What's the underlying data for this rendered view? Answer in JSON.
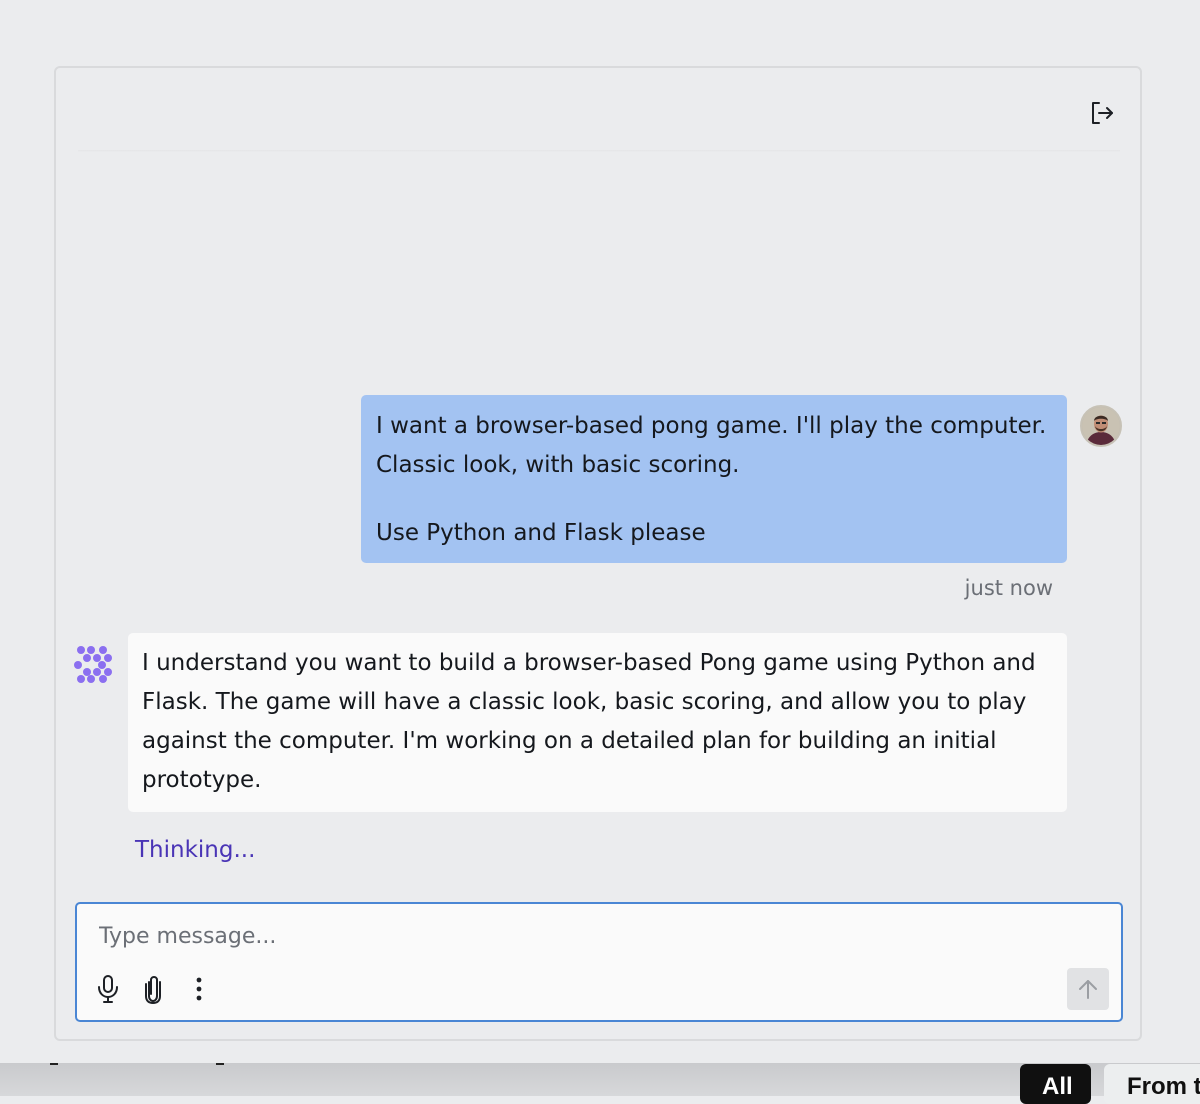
{
  "chat": {
    "messages": [
      {
        "role": "user",
        "lines": [
          "I want a browser-based pong game. I'll play the computer.",
          "Classic look, with basic scoring.",
          "Use Python and Flask please"
        ],
        "timestamp": "just now"
      },
      {
        "role": "assistant",
        "text": "I understand you want to build a browser-based Pong game using Python and Flask. The game will have a classic look, basic scoring, and allow you to play against the computer. I'm working on a detailed plan for building an initial prototype."
      }
    ],
    "status": "Thinking..."
  },
  "composer": {
    "placeholder": "Type message..."
  },
  "icons": {
    "exit": "logout-icon",
    "mic": "microphone-icon",
    "attach": "paperclip-icon",
    "more": "more-vertical-icon",
    "send": "arrow-up-icon",
    "bot": "assistant-logo-icon"
  },
  "filters": {
    "all": "All",
    "from": "From t"
  },
  "colors": {
    "user_bubble": "#a3c3f2",
    "assistant_bubble": "#fafafa",
    "accent": "#4a35b6",
    "logo": "#8b6ff0",
    "input_border": "#4a86d4"
  }
}
